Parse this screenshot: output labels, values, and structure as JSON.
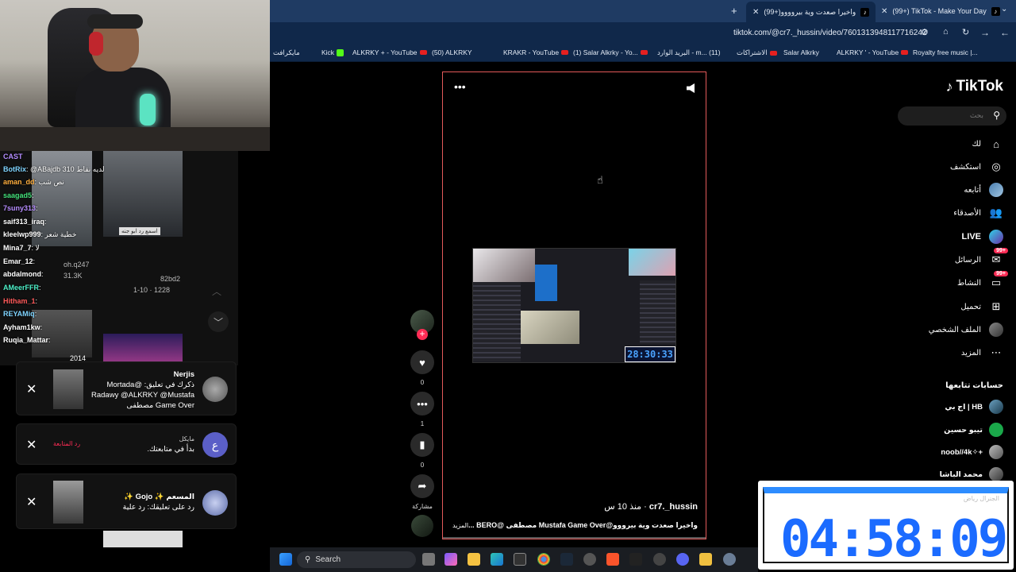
{
  "browser": {
    "tabs": [
      {
        "label": "(99+) TikTok - Make Your Day",
        "active": false
      },
      {
        "label": "(99+)واخيرا صعدت وية بيروووو",
        "active": true
      }
    ],
    "url": "tiktok.com/@cr7._hussin/video/7601313948117716242",
    "bookmarks": [
      "Royalty free music |...",
      "ALKRKY ' - YouTube",
      "Salar Alkrky",
      "الاشتراكات",
      "البريد الوارد - m... (11)",
      "(1) Salar Alkrky - Yo...",
      "KRAKR - YouTube",
      "(50) ALKRKY",
      "ALKRKY + - YouTube",
      "Kick",
      "مايكرافت"
    ]
  },
  "chat": {
    "lines": [
      {
        "user": "CAST",
        "msg": "",
        "color": "#b38cff"
      },
      {
        "user": "BotRix",
        "msg": ": @ABajdb 310 لديه نقاط",
        "color": "#7fd4ff"
      },
      {
        "user": "aman_dd",
        "msg": ": نص شب",
        "color": "#ffae3d"
      },
      {
        "user": "saagad5",
        "msg": ":",
        "color": "#43e07a"
      },
      {
        "user": "7suny313",
        "msg": ":",
        "color": "#b68cff"
      },
      {
        "user": "saif313_iraq",
        "msg": ":",
        "color": "#ffffff"
      },
      {
        "user": "kleelwp999",
        "msg": ": خطية شعر",
        "color": "#ffffff"
      },
      {
        "user": "Mina7_7",
        "msg": ": لا",
        "color": "#ffffff"
      },
      {
        "user": "Emar_12",
        "msg": ":",
        "color": "#ffffff"
      },
      {
        "user": "abdalmond",
        "msg": ":",
        "color": "#ffffff"
      },
      {
        "user": "AMeerFFR",
        "msg": ":",
        "color": "#4df0c8"
      },
      {
        "user": "Hitham_1",
        "msg": ":",
        "color": "#ff5a5a"
      },
      {
        "user": "REYAMiq",
        "msg": ":",
        "color": "#7fd4ff"
      },
      {
        "user": "Ayham1kw",
        "msg": ":",
        "color": "#ffffff"
      },
      {
        "user": "Ruqia_Mattar",
        "msg": ":",
        "color": "#ffffff"
      }
    ],
    "side_texts": [
      "oh.q247",
      "31.3K",
      "82bd2",
      "1-10 · 1228",
      "2014",
      "اسمع رد ابو جنه"
    ]
  },
  "notifications": [
    {
      "title": "Nerjis",
      "body": "ذكرك في تعليق: @Mortada Radawy @ALKRKY @Mustafa Game Over مصطفى",
      "avatar_color": "#8a8a8a"
    },
    {
      "title": "مايكل",
      "body": "بدأ في متابعتك.",
      "action": "رد المتابعة",
      "avatar_letter": "ع",
      "avatar_color": "#5b5fc7"
    },
    {
      "title": "المسعم ✨ Gojo ✨",
      "body": "رد على تعليقك: رد علية",
      "avatar_color": "#9aa7d9"
    }
  ],
  "video": {
    "timer": "28:30:33",
    "author": "cr7._hussin",
    "posted": "منذ 10 س",
    "caption": "واخيرا صعدت وية بيرووو@Mustafa Game Over مصطفى @BERO ...",
    "more": "المزيد"
  },
  "actions": {
    "likes": "0",
    "comments": "1",
    "saves": "0",
    "share_label": "مشاركة"
  },
  "sidebar": {
    "logo": "TikTok",
    "search_placeholder": "بحث",
    "nav": [
      {
        "label": "لك",
        "icon": "home-icon"
      },
      {
        "label": "استكشف",
        "icon": "compass-icon"
      },
      {
        "label": "أتابعه",
        "icon": "avatar-icon"
      },
      {
        "label": "الأصدقاء",
        "icon": "friends-icon"
      },
      {
        "label": "LIVE",
        "icon": "live-icon"
      },
      {
        "label": "الرسائل",
        "icon": "messages-icon",
        "badge": "99+"
      },
      {
        "label": "النشاط",
        "icon": "activity-icon",
        "badge": "99+"
      },
      {
        "label": "تحميل",
        "icon": "upload-icon"
      },
      {
        "label": "الملف الشخصي",
        "icon": "profile-icon"
      },
      {
        "label": "المزيد",
        "icon": "more-icon"
      }
    ],
    "following_header": "حسابات تتابعها",
    "following": [
      "اج بي | HB",
      "تيبو حسين",
      "noob//4k✧+",
      "محمد الباشا",
      "الجنرال رياض"
    ]
  },
  "big_timer": "04:58:09",
  "taskbar": {
    "search_label": "Search"
  },
  "colors": {
    "accent": "#fe2c55",
    "timer_blue": "#1b6bff",
    "browser_tabbar": "#1f3b63"
  }
}
